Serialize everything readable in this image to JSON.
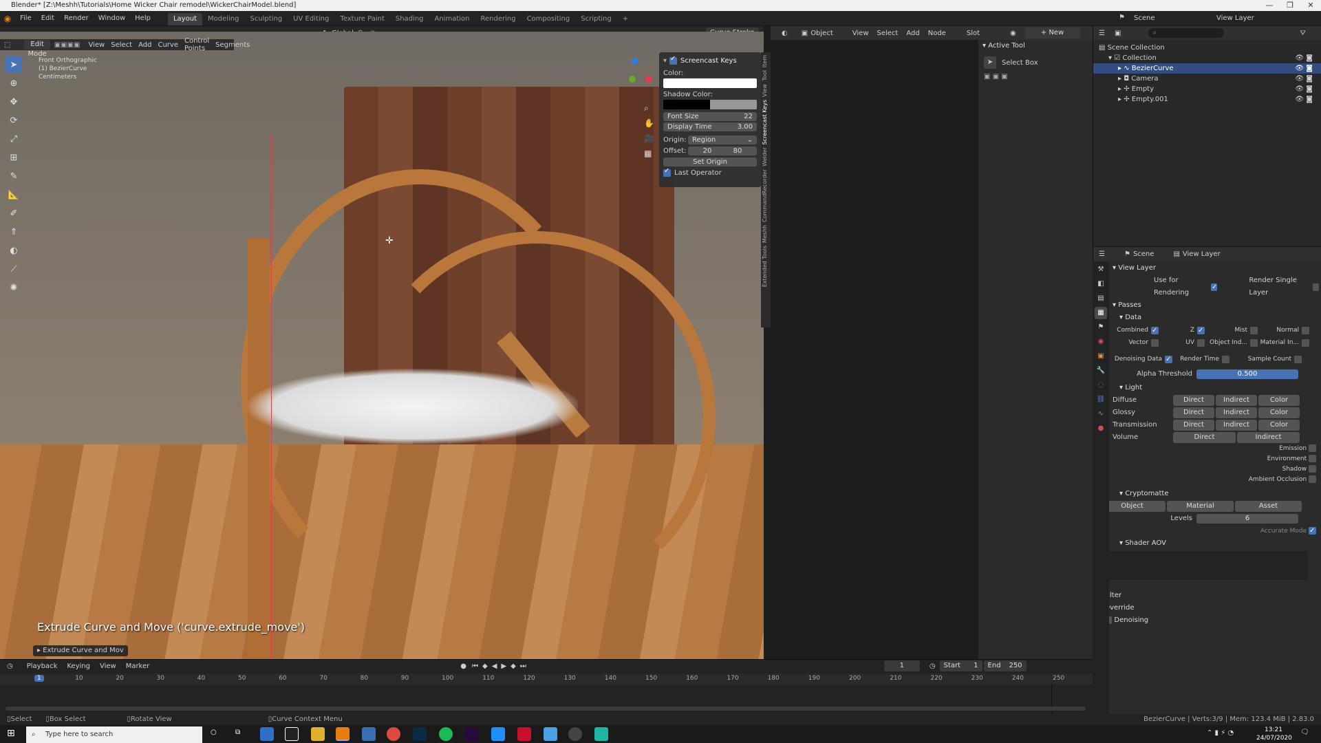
{
  "window": {
    "title": "Blender* [Z:\\Meshh\\Tutorials\\Home Wicker Chair remodel\\WickerChairModel.blend]"
  },
  "menu": [
    "File",
    "Edit",
    "Render",
    "Window",
    "Help"
  ],
  "workspaces": [
    {
      "label": "Layout",
      "active": true
    },
    {
      "label": "Modeling"
    },
    {
      "label": "Sculpting"
    },
    {
      "label": "UV Editing"
    },
    {
      "label": "Texture Paint"
    },
    {
      "label": "Shading"
    },
    {
      "label": "Animation"
    },
    {
      "label": "Rendering"
    },
    {
      "label": "Compositing"
    },
    {
      "label": "Scripting"
    }
  ],
  "scene": {
    "label": "Scene",
    "view_layer": "View Layer"
  },
  "viewport": {
    "transform": "Global",
    "mode": "Edit Mode",
    "header_menus": [
      "View",
      "Select",
      "Add",
      "Curve",
      "Control Points",
      "Segments"
    ],
    "curve_stroke": "Curve Stroke",
    "overlay_info": [
      "Front Orthographic",
      "(1) BezierCurve",
      "Centimeters"
    ],
    "operator_text": "Extrude Curve and Move ('curve.extrude_move')",
    "last_op_panel": "Extrude Curve and Mov"
  },
  "screencast": {
    "title": "Screencast Keys",
    "color_label": "Color:",
    "shadow_label": "Shadow Color:",
    "font_size_label": "Font Size",
    "font_size": "22",
    "display_time_label": "Display Time",
    "display_time": "3.00",
    "origin_label": "Origin:",
    "origin": "Region",
    "offset_label": "Offset:",
    "offset_x": "20",
    "offset_y": "80",
    "set_origin": "Set Origin",
    "last_operator": "Last Operator",
    "tabs": [
      "Item",
      "Tool",
      "View",
      "Screencast Keys",
      "Welder",
      "CommandRecorder",
      "Meshh",
      "Extended Tools"
    ]
  },
  "node_editor": {
    "object_label": "Object",
    "menus": [
      "View",
      "Select",
      "Add",
      "Node"
    ],
    "slot": "Slot",
    "new_button": "New",
    "active_tool_title": "Active Tool",
    "active_tool": "Select Box"
  },
  "outliner": {
    "root": "Scene Collection",
    "items": [
      {
        "label": "Collection",
        "level": 1
      },
      {
        "label": "BezierCurve",
        "level": 2,
        "selected": true
      },
      {
        "label": "Camera",
        "level": 2
      },
      {
        "label": "Empty",
        "level": 2
      },
      {
        "label": "Empty.001",
        "level": 2
      }
    ]
  },
  "properties": {
    "header_scene": "Scene",
    "header_view_layer": "View Layer",
    "view_layer_title": "View Layer",
    "use_for_rendering": "Use for Rendering",
    "render_single_layer": "Render Single Layer",
    "passes": "Passes",
    "data": "Data",
    "combined": "Combined",
    "z": "Z",
    "mist": "Mist",
    "normal": "Normal",
    "vector": "Vector",
    "uv": "UV",
    "object_ind": "Object Ind...",
    "material_in": "Material In...",
    "denoising_data": "Denoising Data",
    "render_time": "Render Time",
    "sample_count": "Sample Count",
    "alpha_threshold_label": "Alpha Threshold",
    "alpha_threshold": "0.500",
    "light": "Light",
    "light_rows": [
      {
        "label": "Diffuse",
        "a": "Direct",
        "b": "Indirect",
        "c": "Color"
      },
      {
        "label": "Glossy",
        "a": "Direct",
        "b": "Indirect",
        "c": "Color"
      },
      {
        "label": "Transmission",
        "a": "Direct",
        "b": "Indirect",
        "c": "Color"
      }
    ],
    "volume": "Volume",
    "volume_a": "Direct",
    "volume_b": "Indirect",
    "light_checks": [
      "Emission",
      "Environment",
      "Shadow",
      "Ambient Occlusion"
    ],
    "cryptomatte": "Cryptomatte",
    "crypto_object": "Object",
    "crypto_material": "Material",
    "crypto_asset": "Asset",
    "levels_label": "Levels",
    "levels": "6",
    "accurate_mode": "Accurate Mode",
    "shader_aov": "Shader AOV",
    "filter": "Filter",
    "override": "Override",
    "denoising": "Denoising"
  },
  "timeline": {
    "menus": [
      "Playback",
      "Keying",
      "View",
      "Marker"
    ],
    "current_frame": "1",
    "start_label": "Start",
    "start": "1",
    "end_label": "End",
    "end": "250",
    "ticks": [
      "1",
      "10",
      "20",
      "30",
      "40",
      "50",
      "60",
      "70",
      "80",
      "90",
      "100",
      "110",
      "120",
      "130",
      "140",
      "150",
      "160",
      "170",
      "180",
      "190",
      "200",
      "210",
      "220",
      "230",
      "240",
      "250"
    ]
  },
  "statusbar": {
    "select": "Select",
    "box_select": "Box Select",
    "rotate_view": "Rotate View",
    "context_menu": "Curve Context Menu",
    "info": "BezierCurve | Verts:3/9 | Mem: 123.4 MiB | 2.83.0"
  },
  "taskbar": {
    "search_placeholder": "Type here to search",
    "time": "13:21",
    "date": "24/07/2020"
  }
}
